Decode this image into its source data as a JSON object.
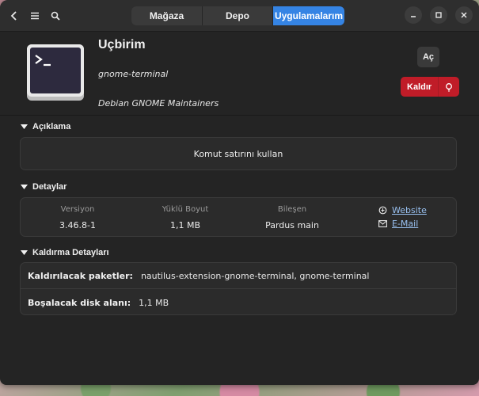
{
  "header": {
    "tabs": [
      {
        "label": "Mağaza",
        "active": false
      },
      {
        "label": "Depo",
        "active": false
      },
      {
        "label": "Uygulamalarım",
        "active": true
      }
    ],
    "back_icon": "back-icon",
    "menu_icon": "hamburger-menu-icon",
    "search_icon": "search-icon",
    "window_controls": [
      "minimize-icon",
      "maximize-icon",
      "close-icon"
    ]
  },
  "app": {
    "name": "Uçbirim",
    "id": "gnome-terminal",
    "developer": "Debian GNOME Maintainers",
    "open_label": "Aç",
    "remove_label": "Kaldır",
    "icon": "terminal-icon"
  },
  "description": {
    "title": "Açıklama",
    "text": "Komut satırını kullan"
  },
  "details": {
    "title": "Detaylar",
    "version_label": "Versiyon",
    "version_value": "3.46.8-1",
    "size_label": "Yüklü Boyut",
    "size_value": "1,1 MB",
    "component_label": "Bileşen",
    "component_value": "Pardus main",
    "website_label": "Website",
    "email_label": "E-Mail"
  },
  "removal": {
    "title": "Kaldırma Detayları",
    "packages_label": "Kaldırılacak paketler:",
    "packages_value": "nautilus-extension-gnome-terminal, gnome-terminal",
    "freed_label": "Boşalacak disk alanı:",
    "freed_value": "1,1 MB"
  },
  "colors": {
    "accent": "#3584e4",
    "destructive": "#c01c28",
    "link": "#99c1f1",
    "window_bg": "#242424"
  }
}
